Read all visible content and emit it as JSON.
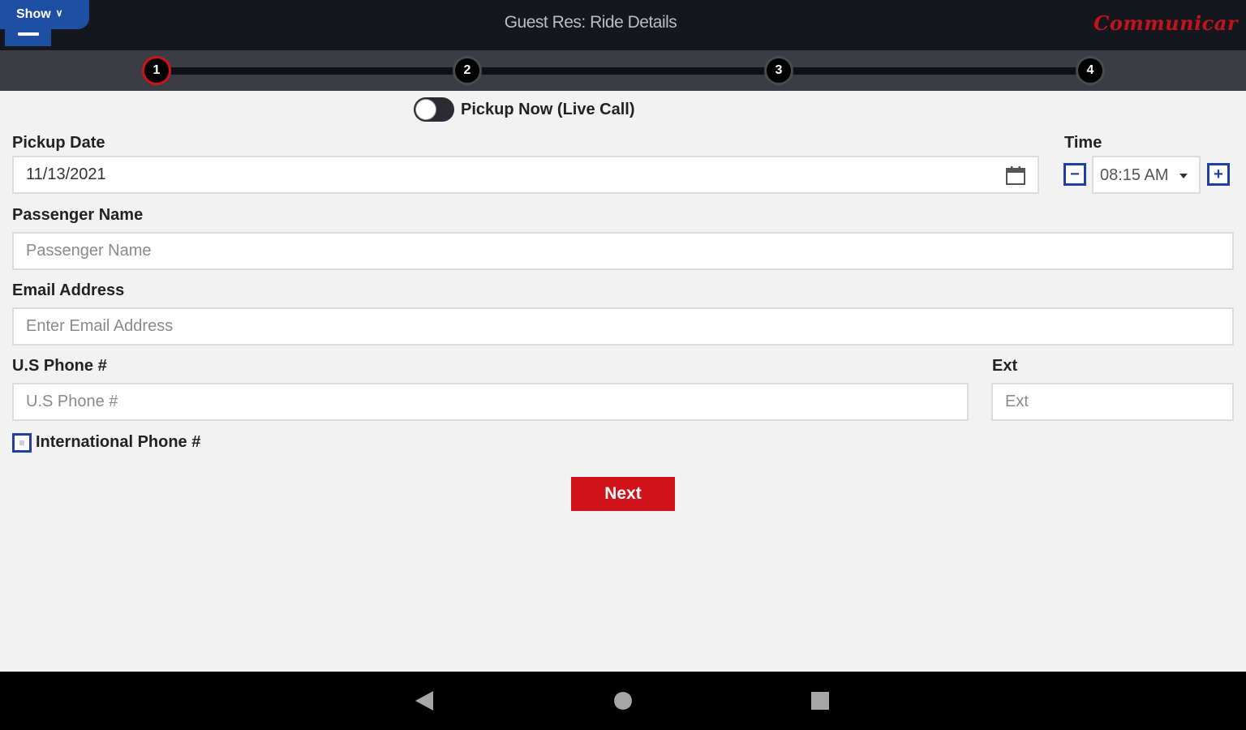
{
  "header": {
    "show_label": "Show",
    "title": "Guest Res: Ride Details",
    "logo_text": "Communicar"
  },
  "stepper": {
    "steps": [
      "1",
      "2",
      "3",
      "4"
    ],
    "active_step": 1
  },
  "toggle": {
    "label": "Pickup Now (Live Call)",
    "on": false
  },
  "pickup_date": {
    "label": "Pickup Date",
    "value": "11/13/2021"
  },
  "time": {
    "label": "Time",
    "value": "08:15 AM",
    "minus": "−",
    "plus": "+"
  },
  "passenger": {
    "label": "Passenger Name",
    "placeholder": "Passenger Name"
  },
  "email": {
    "label": "Email Address",
    "placeholder": "Enter Email Address"
  },
  "phone": {
    "label": "U.S Phone #",
    "placeholder": "U.S Phone #"
  },
  "ext": {
    "label": "Ext",
    "placeholder": "Ext"
  },
  "intl": {
    "label": "International Phone #",
    "checked": false
  },
  "next_label": "Next",
  "colors": {
    "brand_red": "#d0131b",
    "brand_blue": "#1f4fa3",
    "topbar": "#16161f"
  },
  "icons": [
    "menu-icon",
    "chevron-down-icon",
    "calendar-icon",
    "minus-icon",
    "plus-icon",
    "caret-down-icon",
    "back-icon",
    "home-icon",
    "recents-icon"
  ]
}
